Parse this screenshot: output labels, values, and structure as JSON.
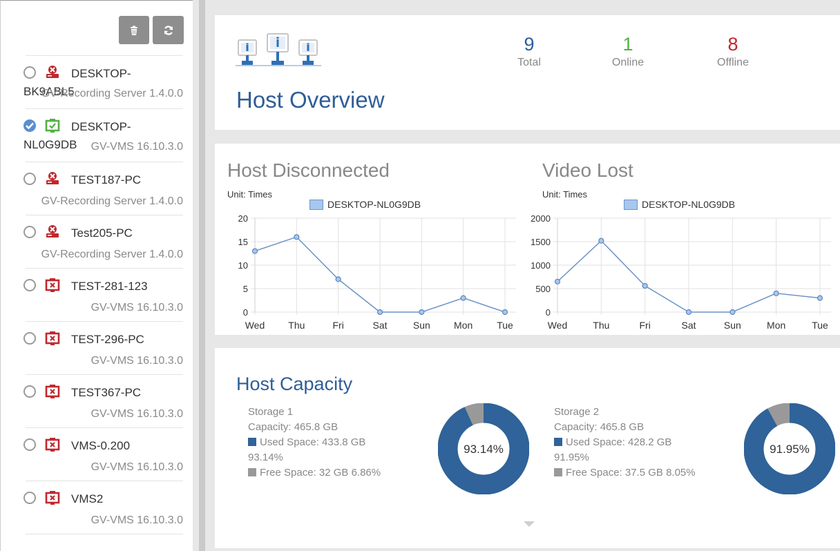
{
  "toolbar": {
    "delete_icon": "trash-icon",
    "refresh_icon": "refresh-icon"
  },
  "hosts": [
    {
      "name": "DESKTOP-",
      "name2": "BK9ABL5",
      "version": "GV-Recording Server 1.4.0.0",
      "status": "offline",
      "type": "recording-server",
      "checked": false
    },
    {
      "name": "DESKTOP-",
      "name2": "NL0G9DB",
      "version": "GV-VMS 16.10.3.0",
      "status": "online",
      "type": "vms",
      "checked": true
    },
    {
      "name": "TEST187-PC",
      "version": "GV-Recording Server 1.4.0.0",
      "status": "offline",
      "type": "recording-server",
      "checked": false
    },
    {
      "name": "Test205-PC",
      "version": "GV-Recording Server 1.4.0.0",
      "status": "offline",
      "type": "recording-server",
      "checked": false
    },
    {
      "name": "TEST-281-123",
      "version": "GV-VMS 16.10.3.0",
      "status": "offline",
      "type": "vms",
      "checked": false
    },
    {
      "name": "TEST-296-PC",
      "version": "GV-VMS 16.10.3.0",
      "status": "offline",
      "type": "vms",
      "checked": false
    },
    {
      "name": "TEST367-PC",
      "version": "GV-VMS 16.10.3.0",
      "status": "offline",
      "type": "vms",
      "checked": false
    },
    {
      "name": "VMS-0.200",
      "version": "GV-VMS 16.10.3.0",
      "status": "offline",
      "type": "vms",
      "checked": false
    },
    {
      "name": "VMS2",
      "version": "GV-VMS 16.10.3.0",
      "status": "offline",
      "type": "vms",
      "checked": false
    }
  ],
  "overview": {
    "title": "Host Overview",
    "total": {
      "value": "9",
      "label": "Total"
    },
    "online": {
      "value": "1",
      "label": "Online"
    },
    "offline": {
      "value": "8",
      "label": "Offline"
    }
  },
  "colors": {
    "accent": "#2f5d99",
    "online": "#52b043",
    "offline": "#c0282d",
    "used": "#2f6399",
    "free": "#999999"
  },
  "chart_data": [
    {
      "type": "line",
      "title": "Host Disconnected",
      "unit": "Unit: Times",
      "categories": [
        "Wed",
        "Thu",
        "Fri",
        "Sat",
        "Sun",
        "Mon",
        "Tue"
      ],
      "series": [
        {
          "name": "DESKTOP-NL0G9DB",
          "values": [
            13,
            16,
            7,
            0,
            0,
            3,
            0
          ]
        }
      ],
      "ylim": [
        0,
        20
      ],
      "yticks": [
        0,
        5,
        10,
        15,
        20
      ],
      "grid": true,
      "legend": "top"
    },
    {
      "type": "line",
      "title": "Video Lost",
      "unit": "Unit: Times",
      "categories": [
        "Wed",
        "Thu",
        "Fri",
        "Sat",
        "Sun",
        "Mon",
        "Tue"
      ],
      "series": [
        {
          "name": "DESKTOP-NL0G9DB",
          "values": [
            650,
            1520,
            560,
            0,
            0,
            400,
            300
          ]
        }
      ],
      "ylim": [
        0,
        2000
      ],
      "yticks": [
        0,
        500,
        1000,
        1500,
        2000
      ],
      "grid": true,
      "legend": "top"
    }
  ],
  "capacity": {
    "title": "Host Capacity",
    "storages": [
      {
        "name": "Storage 1",
        "capacity": "Capacity: 465.8 GB",
        "used": "Used Space: 433.8 GB",
        "used_pct": "93.14%",
        "free": "Free Space: 32 GB 6.86%",
        "used_fraction": 0.9314
      },
      {
        "name": "Storage 2",
        "capacity": "Capacity: 465.8 GB",
        "used": "Used Space: 428.2 GB",
        "used_pct": "91.95%",
        "free": "Free Space: 37.5 GB 8.05%",
        "used_fraction": 0.9195
      }
    ]
  }
}
